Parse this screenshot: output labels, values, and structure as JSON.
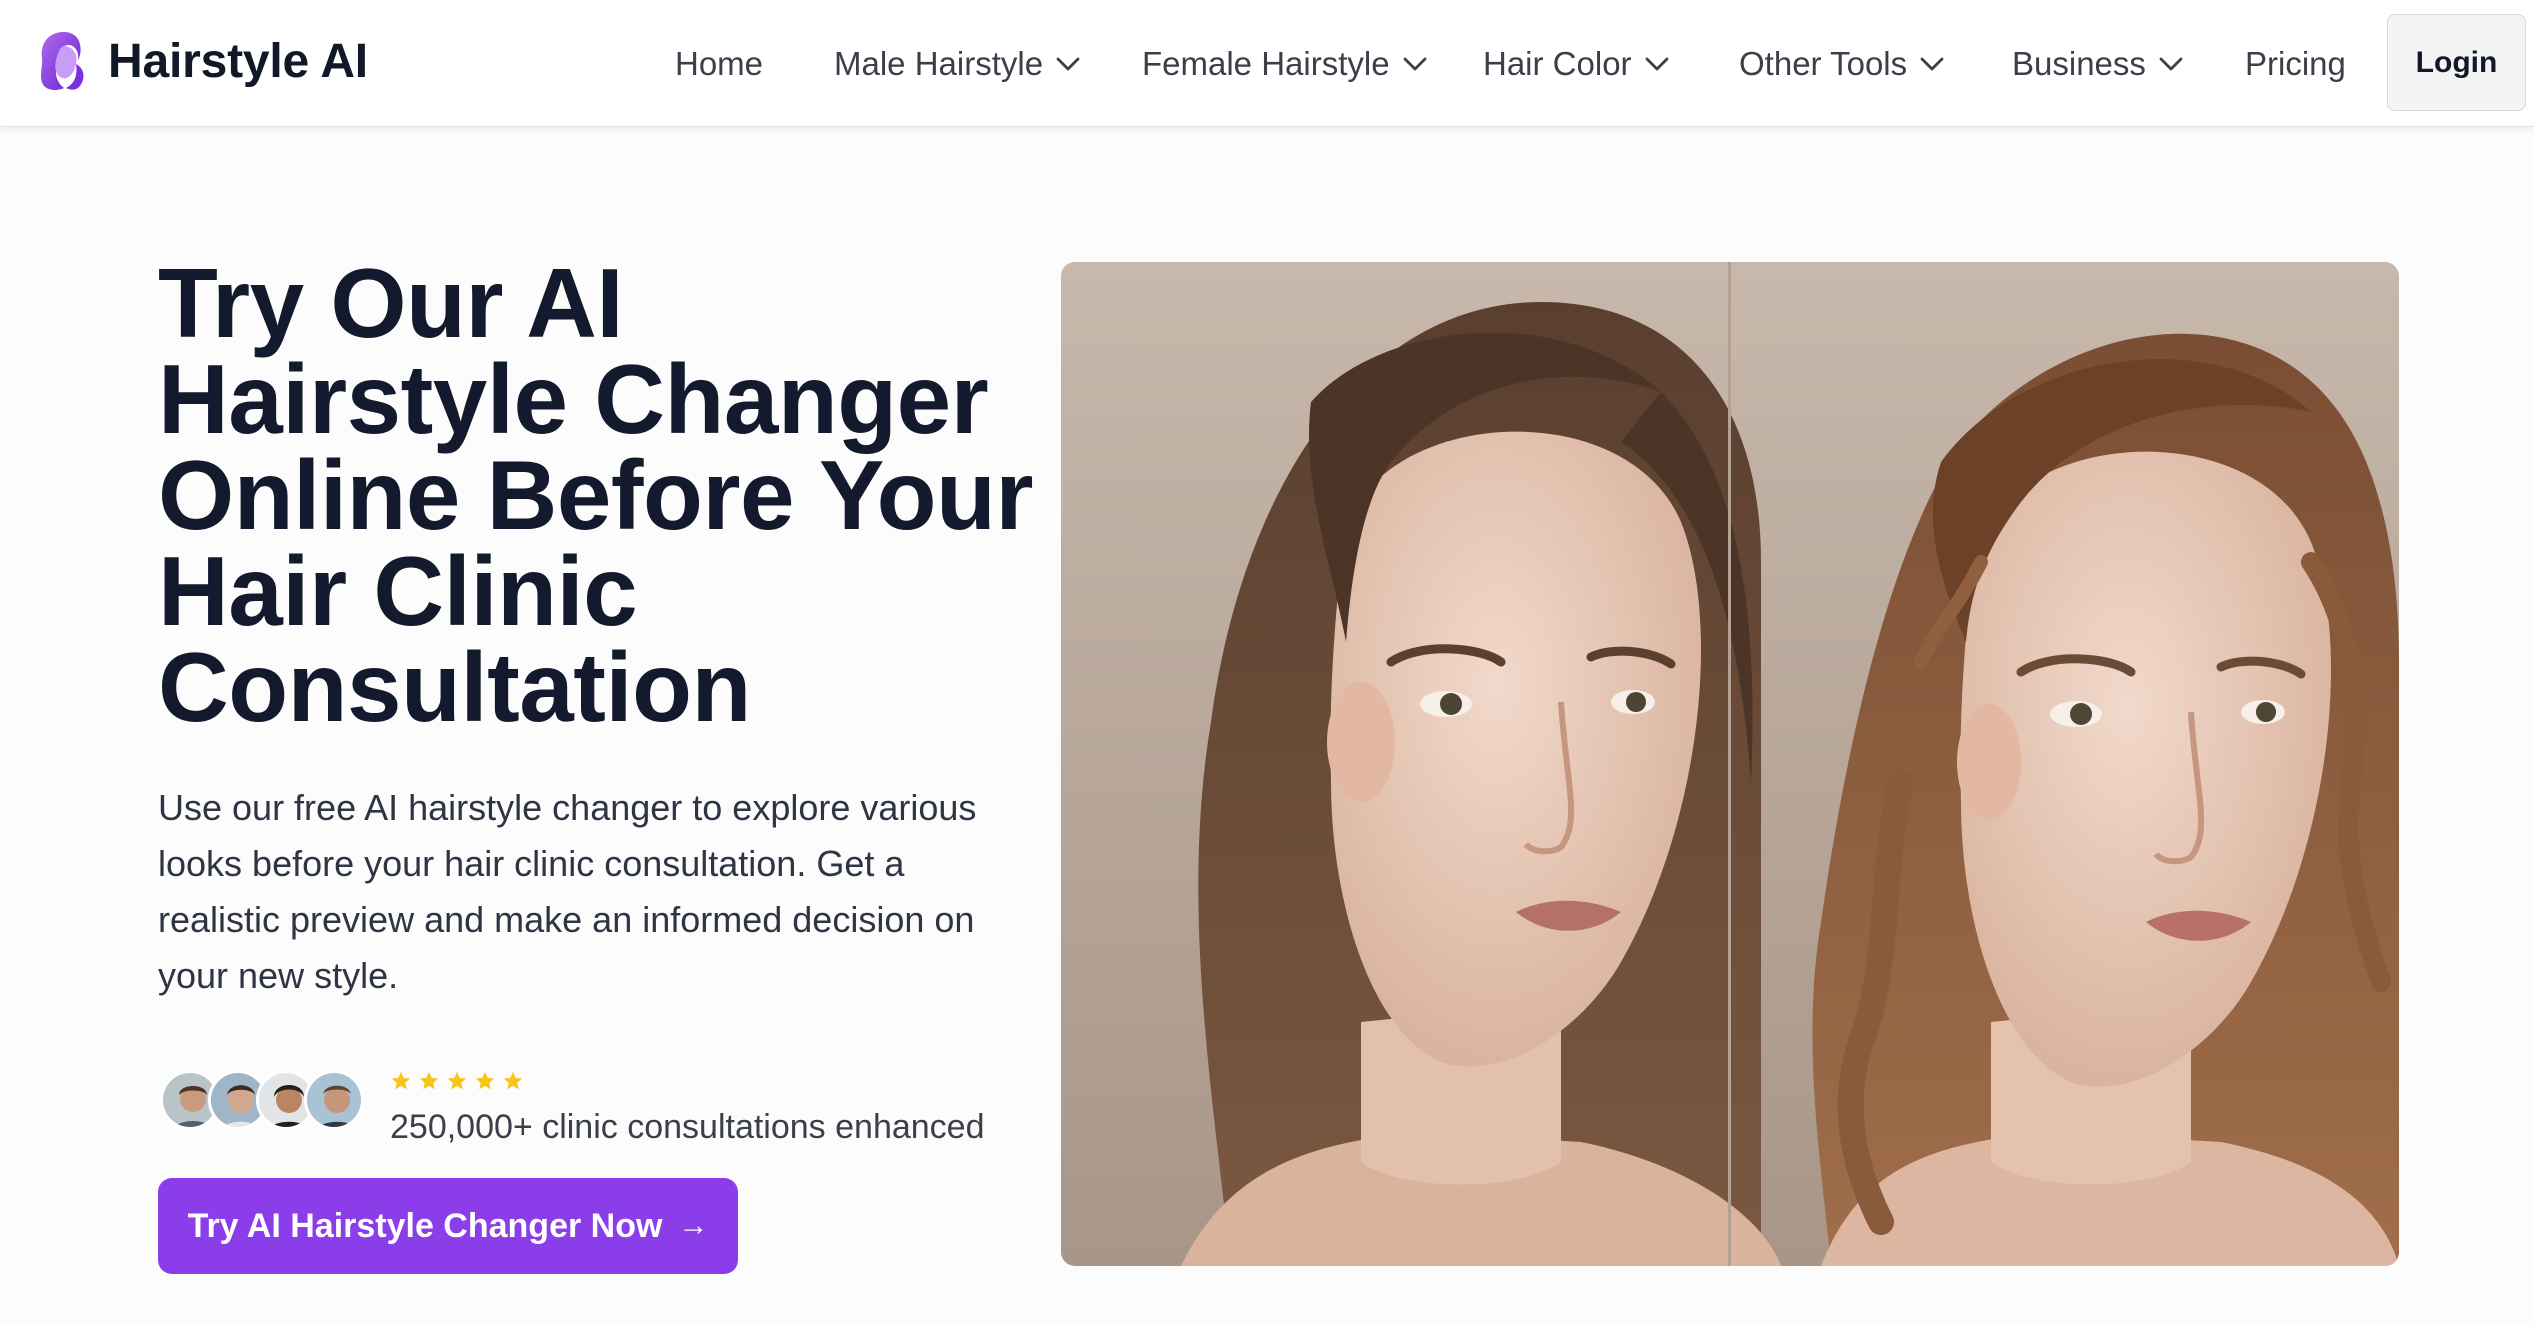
{
  "brand": {
    "name": "Hairstyle AI",
    "icon": "woman-hair-logo-icon",
    "accent_color": "#8b3dea"
  },
  "nav": {
    "items": [
      {
        "label": "Home",
        "dropdown": false
      },
      {
        "label": "Male Hairstyle",
        "dropdown": true
      },
      {
        "label": "Female Hairstyle",
        "dropdown": true
      },
      {
        "label": "Hair Color",
        "dropdown": true
      },
      {
        "label": "Other Tools",
        "dropdown": true
      },
      {
        "label": "Business",
        "dropdown": true
      },
      {
        "label": "Pricing",
        "dropdown": false
      }
    ],
    "login_label": "Login"
  },
  "hero": {
    "title_lines": [
      "Try Our AI",
      "Hairstyle Changer",
      "Online Before Your",
      "Hair Clinic",
      "Consultation"
    ],
    "description_lines": [
      "Use our free AI hairstyle changer to explore various",
      "looks before your hair clinic consultation. Get a",
      "realistic preview and make an informed decision on",
      "your new style."
    ],
    "rating_stars": 5,
    "star_color": "#f5c518",
    "social_proof": "250,000+ clinic consultations enhanced",
    "cta_label": "Try AI Hairstyle Changer Now",
    "cta_icon": "arrow-right-icon",
    "image_description_icon": "before-after-portrait-image"
  }
}
